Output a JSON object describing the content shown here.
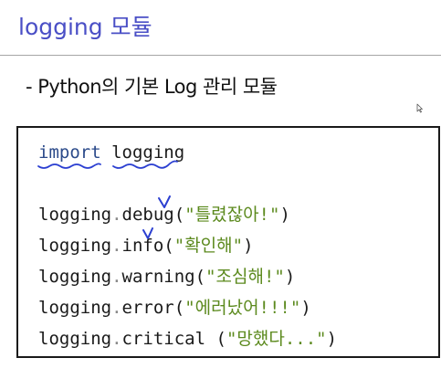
{
  "header": {
    "title": "logging 모듈"
  },
  "subtitle": "- Python의 기본 Log 관리 모듈",
  "code": {
    "import_keyword": "import",
    "import_module": "logging",
    "lines": [
      {
        "object": "logging",
        "dot": ".",
        "method": "debug",
        "open": "(",
        "string": "\"틀렸잖아!\"",
        "close": ")"
      },
      {
        "object": "logging",
        "dot": ".",
        "method": "info",
        "open": "(",
        "string": "\"확인해\"",
        "close": ")"
      },
      {
        "object": "logging",
        "dot": ".",
        "method": "warning",
        "open": "(",
        "string": "\"조심해!\"",
        "close": ")"
      },
      {
        "object": "logging",
        "dot": ".",
        "method": "error",
        "open": "(",
        "string": "\"에러났어!!!\"",
        "close": ")"
      },
      {
        "object": "logging",
        "dot": ".",
        "method": "critical",
        "open": " (",
        "string": "\"망했다...\"",
        "close": ")"
      }
    ]
  },
  "colors": {
    "title": "#4a4fc6",
    "keyword": "#2b4a8a",
    "string": "#5c8a1e",
    "annotation": "#2b3fd1"
  },
  "icons": {
    "cursor": "mouse-pointer-icon"
  }
}
